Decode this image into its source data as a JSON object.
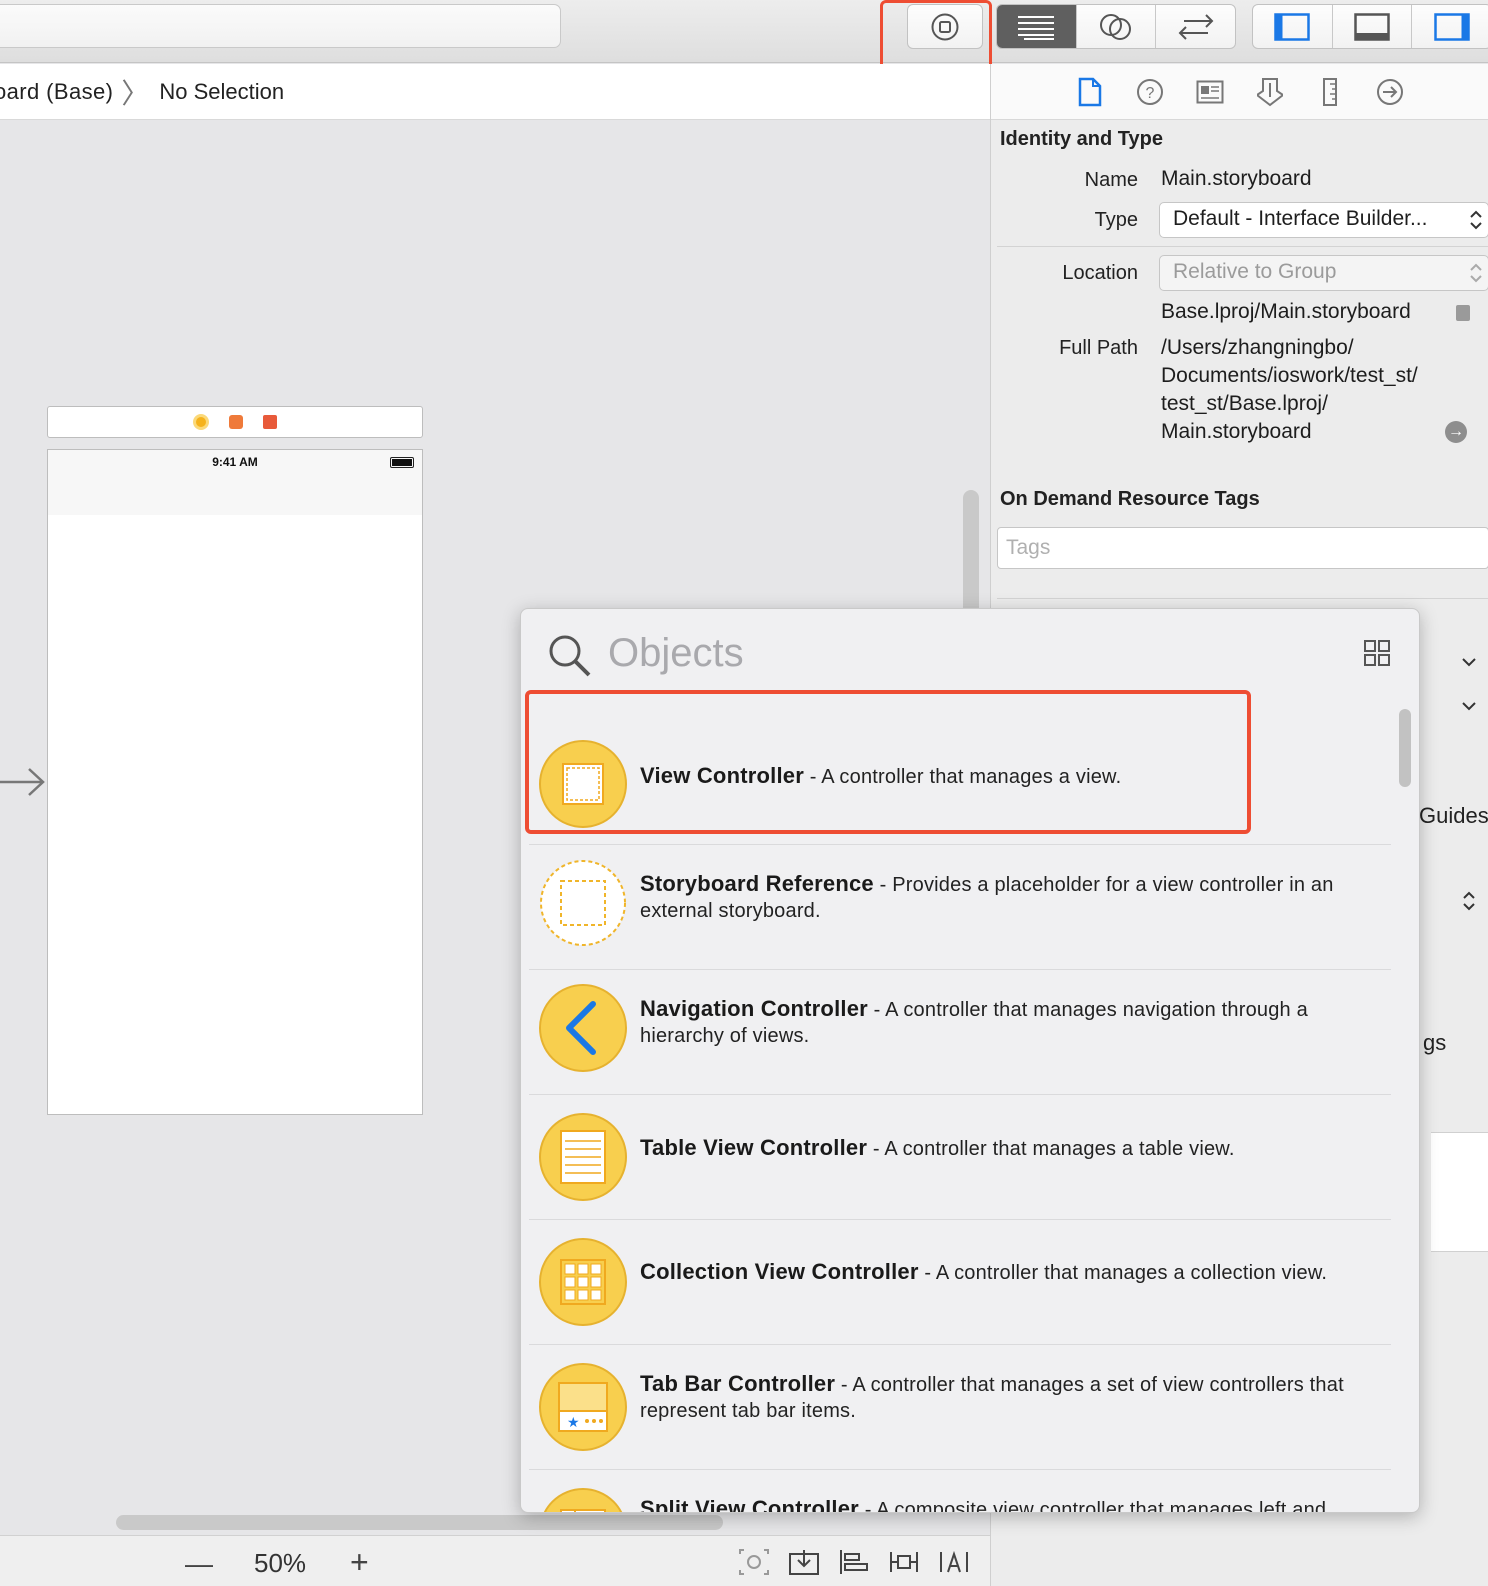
{
  "jumpbar": {
    "crumb": "oard (Base)",
    "selection": "No Selection"
  },
  "canvas": {
    "status_time": "9:41 AM",
    "zoom_level": "50%",
    "zoom_out": "—",
    "zoom_in": "+"
  },
  "inspector": {
    "identity_title": "Identity and Type",
    "name_label": "Name",
    "name_value": "Main.storyboard",
    "type_label": "Type",
    "type_value": "Default - Interface Builder...",
    "location_label": "Location",
    "location_value": "Relative to Group",
    "relative_path": "Base.lproj/Main.storyboard",
    "full_path_label": "Full Path",
    "full_path_lines": [
      "/Users/zhangningbo/",
      "Documents/ioswork/test_st/",
      "test_st/Base.lproj/",
      "Main.storyboard"
    ],
    "odr_title": "On Demand Resource Tags",
    "tags_placeholder": "Tags",
    "peek_guides": "Guides",
    "peek_gs": "gs"
  },
  "library": {
    "search_placeholder": "Objects",
    "items": [
      {
        "name": "View Controller",
        "desc": " - A controller that manages a view.",
        "icon": "view-controller-icon"
      },
      {
        "name": "Storyboard Reference",
        "desc": " - Provides a placeholder for a view controller in an external storyboard.",
        "icon": "storyboard-reference-icon"
      },
      {
        "name": "Navigation Controller",
        "desc": " - A controller that manages navigation through a hierarchy of views.",
        "icon": "navigation-controller-icon"
      },
      {
        "name": "Table View Controller",
        "desc": " - A controller that manages a table view.",
        "icon": "table-view-controller-icon"
      },
      {
        "name": "Collection View Controller",
        "desc": " - A controller that manages a collection view.",
        "icon": "collection-view-controller-icon"
      },
      {
        "name": "Tab Bar Controller",
        "desc": " - A controller that manages a set of view controllers that represent tab bar items.",
        "icon": "tab-bar-controller-icon"
      },
      {
        "name": "Split View Controller",
        "desc": " - A composite view controller that manages left and",
        "icon": "split-view-controller-icon"
      }
    ]
  },
  "colors": {
    "highlight": "#ee4d33",
    "icon_yellow": "#f8cf4e",
    "accent_blue": "#1a78e6"
  }
}
